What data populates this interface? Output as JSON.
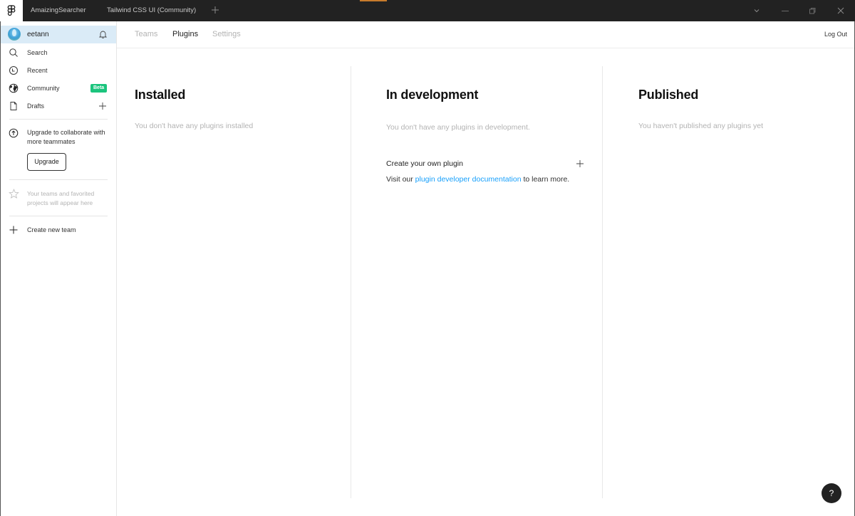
{
  "titlebar": {
    "tabs": [
      {
        "label": "AmaizingSearcher"
      },
      {
        "label": "Tailwind CSS UI (Community)"
      }
    ],
    "accent_color": "#c77b2c"
  },
  "sidebar": {
    "user": {
      "name": "eetann"
    },
    "nav": [
      {
        "label": "Search",
        "icon": "search-icon"
      },
      {
        "label": "Recent",
        "icon": "clock-icon"
      },
      {
        "label": "Community",
        "icon": "globe-icon",
        "badge": "Beta"
      },
      {
        "label": "Drafts",
        "icon": "file-icon"
      }
    ],
    "upgrade": {
      "text": "Upgrade to collaborate with more teammates",
      "button": "Upgrade"
    },
    "favorites_empty": "Your teams and favorited projects will appear here",
    "create_team": "Create new team",
    "badge_color": "#1bc47d",
    "active_row_color": "#daebf7"
  },
  "header": {
    "tabs": [
      {
        "label": "Teams",
        "active": false
      },
      {
        "label": "Plugins",
        "active": true
      },
      {
        "label": "Settings",
        "active": false
      }
    ],
    "logout": "Log Out"
  },
  "main": {
    "columns": [
      {
        "title": "Installed",
        "empty": "You don't have any plugins installed"
      },
      {
        "title": "In development",
        "empty": "You don't have any plugins in development."
      },
      {
        "title": "Published",
        "empty": "You haven't published any plugins yet"
      }
    ],
    "create_plugin": {
      "title": "Create your own plugin",
      "desc_before": "Visit our ",
      "link": "plugin developer documentation",
      "desc_after": " to learn more.",
      "link_color": "#18a0fb"
    }
  },
  "help": {
    "label": "?"
  }
}
